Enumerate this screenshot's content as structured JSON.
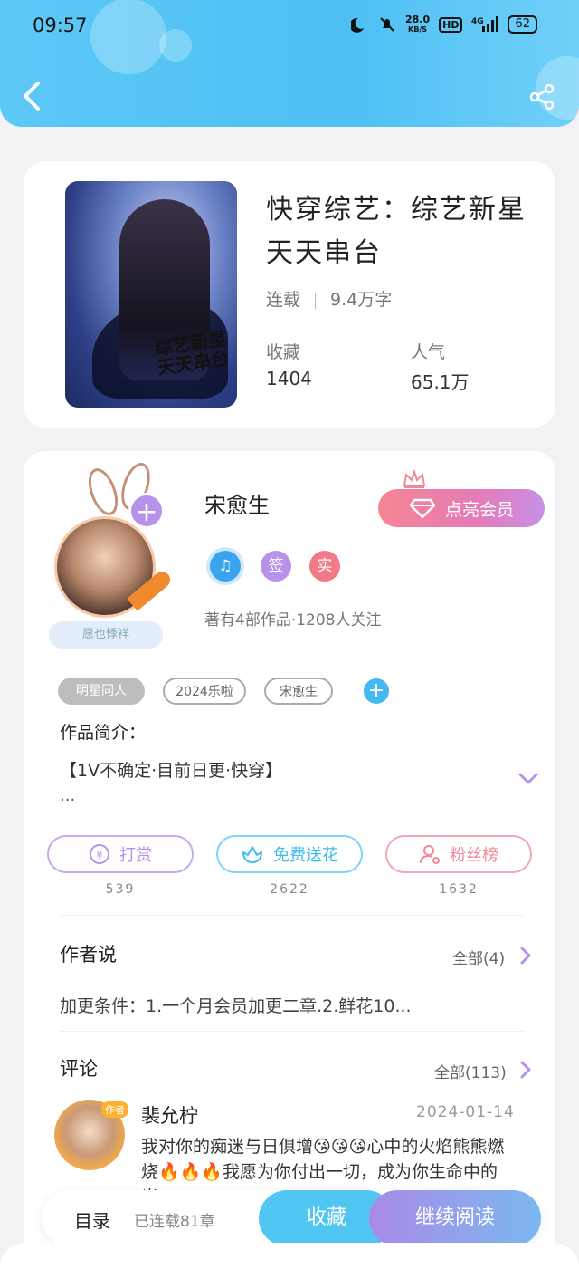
{
  "status_bar": {
    "time": "09:57",
    "net_speed": "28.0",
    "net_unit": "KB/S",
    "hd": "HD",
    "signal": "4G",
    "battery": "62"
  },
  "book": {
    "title": "快穿综艺：综艺新星天天串台",
    "cover_text": "综艺新星天天串台",
    "status": "连载",
    "word_count": "9.4万字",
    "collect_label": "收藏",
    "collect_value": "1404",
    "popularity_label": "人气",
    "popularity_value": "65.1万"
  },
  "author": {
    "name": "宋愈生",
    "vip_button": "点亮会员",
    "fan_badge": "愿也悸祥",
    "badges": [
      {
        "text": "♫",
        "color": "#3aa4ee"
      },
      {
        "text": "签",
        "color": "#b692ea"
      },
      {
        "text": "实",
        "color": "#f07a86"
      }
    ],
    "stats": "著有4部作品·1208人关注"
  },
  "tags": [
    "明星同人",
    "2024乐啦",
    "宋愈生"
  ],
  "intro": {
    "label": "作品简介：",
    "text": "【1V不确定·目前日更·快穿】",
    "ellipsis": "..."
  },
  "actions": [
    {
      "label": "打赏",
      "count": "539",
      "color": "#b692ea"
    },
    {
      "label": "免费送花",
      "count": "2622",
      "color": "#4fc5ef"
    },
    {
      "label": "粉丝榜",
      "count": "1632",
      "color": "#f08a96"
    }
  ],
  "author_says": {
    "title": "作者说",
    "all": "全部(4)",
    "text": "加更条件：1.一个月会员加更二章.2.鲜花10..."
  },
  "comments": {
    "title": "评论",
    "all": "全部(113)",
    "items": [
      {
        "author_badge": "作者",
        "name": "裴允柠",
        "date": "2024-01-14",
        "text": "我对你的痴迷与日俱增😘😘😘心中的火焰熊熊燃烧🔥🔥🔥我愿为你付出一切，成为你生命中的光..."
      }
    ]
  },
  "bottom_bar": {
    "toc": "目录",
    "toc_count": "已连载81章",
    "favorite": "收藏",
    "continue": "继续阅读"
  }
}
